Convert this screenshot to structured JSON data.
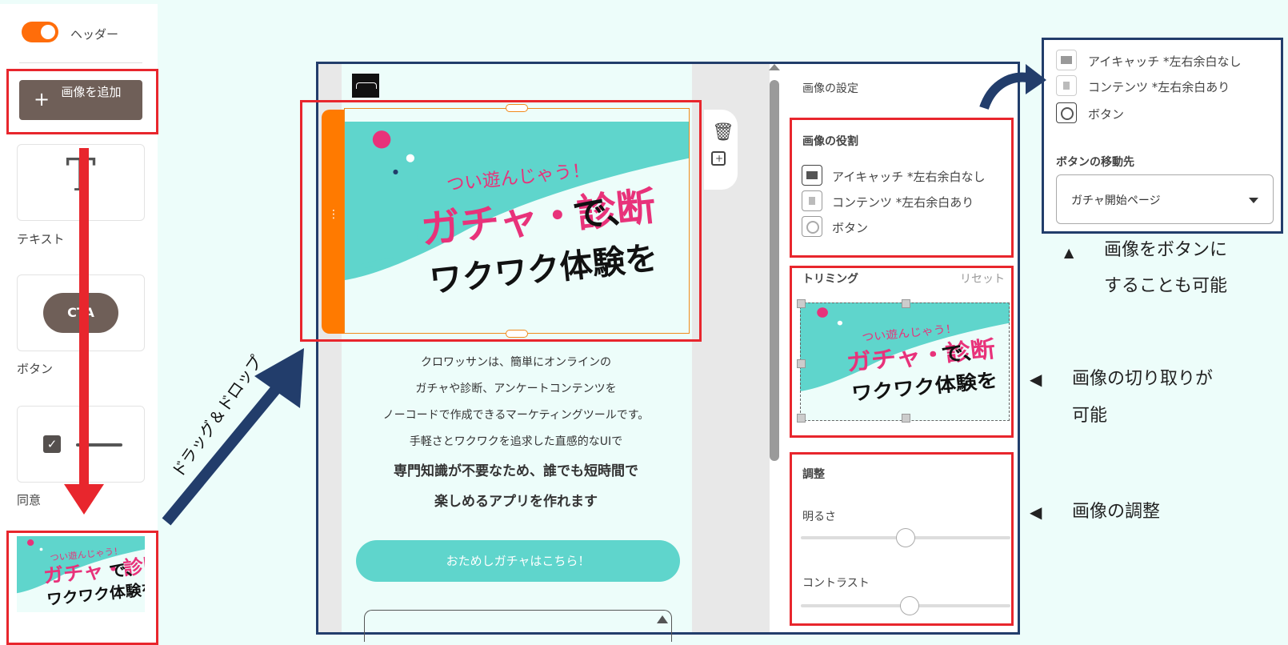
{
  "palette": {
    "header_label": "ヘッダー",
    "add_image_label": "画像を追加",
    "items": [
      {
        "label": "テキスト",
        "icon_text": "T"
      },
      {
        "label": "ボタン",
        "icon_text": "CTA"
      },
      {
        "label": "同意",
        "icon_text": "✓"
      }
    ]
  },
  "annotations": {
    "drag_drop": "ドラッグ＆ドロップ"
  },
  "hero_image": {
    "tagline": "つい遊んじゃう！",
    "main_pink": "ガチャ・診断",
    "main_black": "で、",
    "subtitle": "ワクワク体験を"
  },
  "preview": {
    "description_lines": [
      "クロワッサンは、簡単にオンラインの",
      "ガチャや診断、アンケートコンテンツを",
      "ノーコードで作成できるマーケティングツールです。",
      "手軽さとワクワクを追求した直感的なUIで"
    ],
    "bold_lines": [
      "専門知識が不要なため、誰でも短時間で",
      "楽しめるアプリを作れます"
    ],
    "try_button": "おためしガチャはこちら！"
  },
  "settings": {
    "title": "画像の設定",
    "role_title": "画像の役割",
    "roles": [
      "アイキャッチ *左右余白なし",
      "コンテンツ *左右余白あり",
      "ボタン"
    ],
    "trim_title": "トリミング",
    "reset": "リセット",
    "adjust_title": "調整",
    "brightness_label": "明るさ",
    "brightness": 0.5,
    "contrast_label": "コントラスト",
    "contrast": 0.52
  },
  "popup": {
    "roles": [
      "アイキャッチ *左右余白なし",
      "コンテンツ *左右余白あり",
      "ボタン"
    ],
    "destination_label": "ボタンの移動先",
    "destination_value": "ガチャ開始ページ"
  },
  "notes": {
    "button_marker": "▲",
    "button_line1": "画像をボタンに",
    "button_line2": "することも可能",
    "crop_marker": "◀",
    "crop_line1": "画像の切り取りが",
    "crop_line2": "可能",
    "adjust_marker": "◀",
    "adjust_line1": "画像の調整"
  },
  "colors": {
    "accent_orange": "#ff7a00",
    "brand_brown": "#6f5f58",
    "teal": "#5fd5cc",
    "highlight_red": "#e8262d",
    "frame_navy": "#223d6b"
  }
}
